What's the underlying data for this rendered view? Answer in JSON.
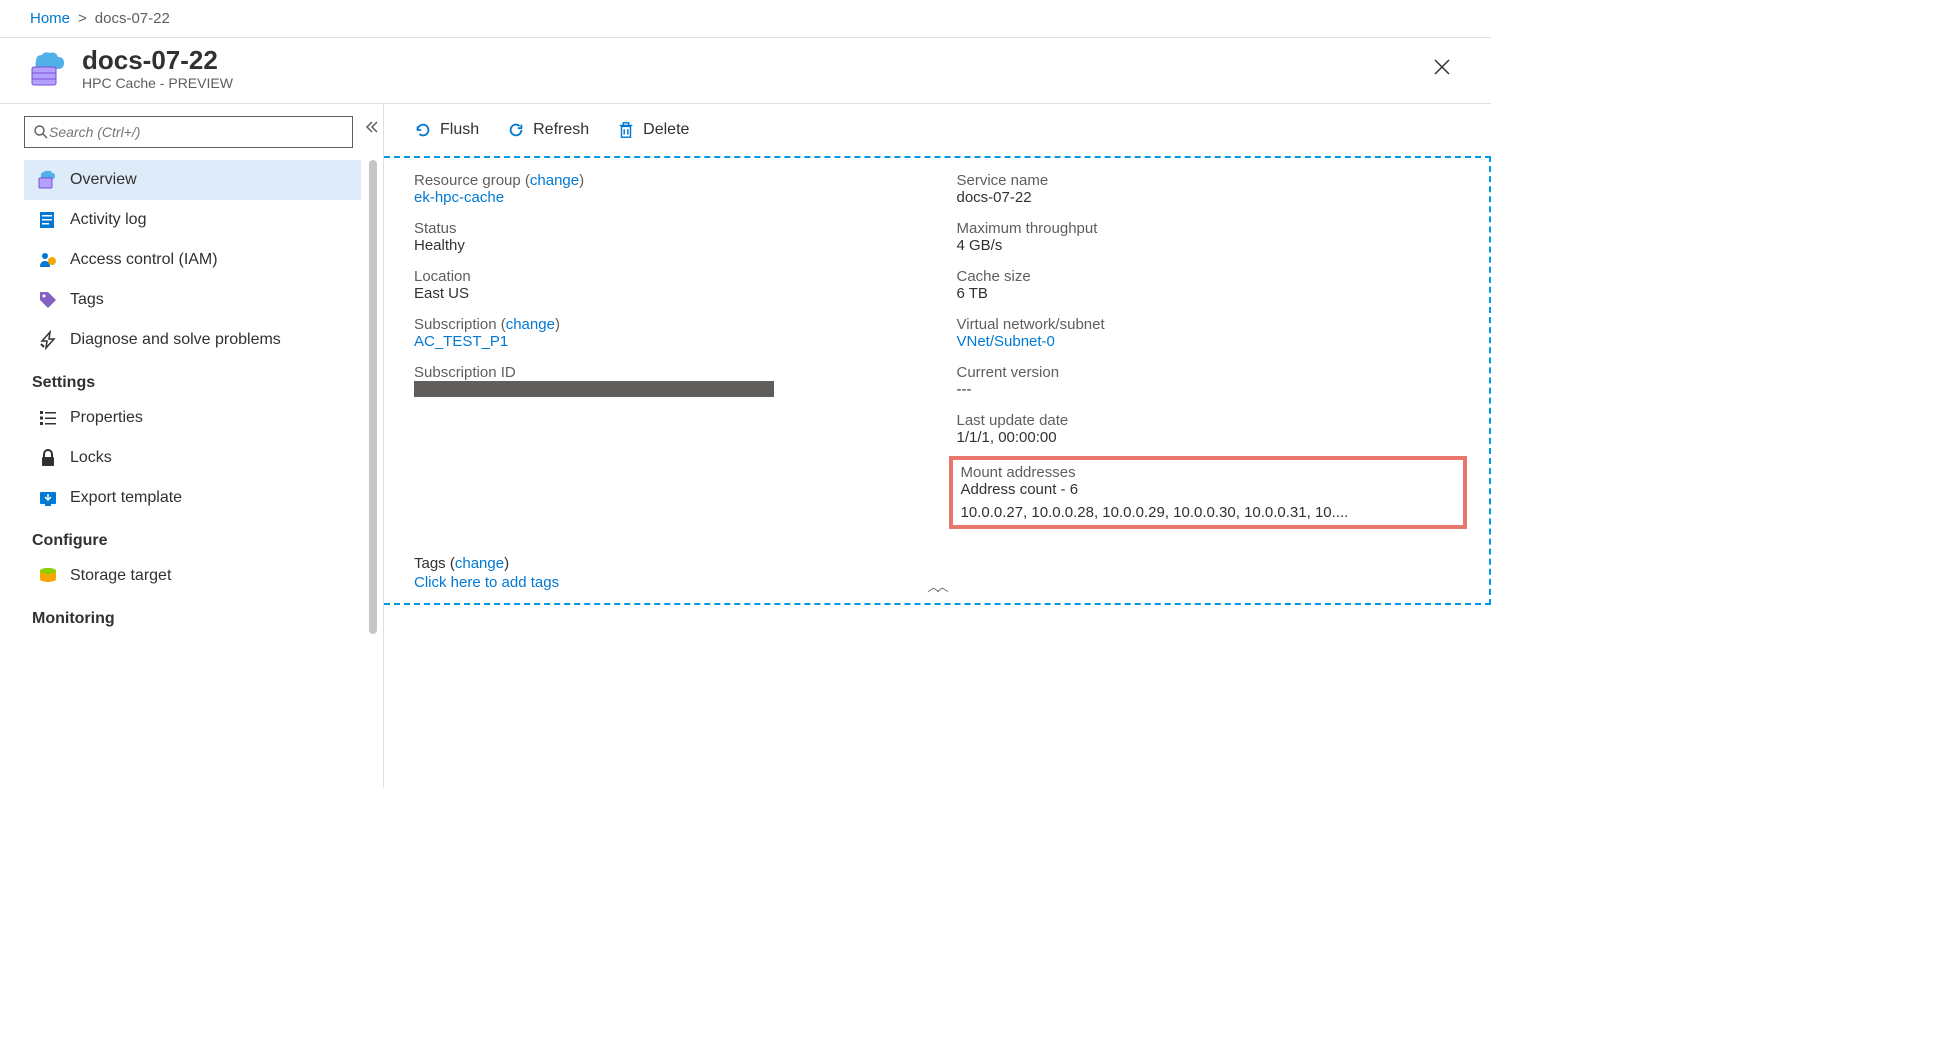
{
  "breadcrumb": {
    "home": "Home",
    "current": "docs-07-22"
  },
  "header": {
    "title": "docs-07-22",
    "subtitle": "HPC Cache - PREVIEW"
  },
  "search": {
    "placeholder": "Search (Ctrl+/)"
  },
  "nav": {
    "overview": "Overview",
    "activity_log": "Activity log",
    "access_control": "Access control (IAM)",
    "tags": "Tags",
    "diagnose": "Diagnose and solve problems",
    "group_settings": "Settings",
    "properties": "Properties",
    "locks": "Locks",
    "export_template": "Export template",
    "group_configure": "Configure",
    "storage_target": "Storage target",
    "group_monitoring": "Monitoring"
  },
  "toolbar": {
    "flush": "Flush",
    "refresh": "Refresh",
    "delete": "Delete"
  },
  "essentials": {
    "left": {
      "resource_group_label": "Resource group (",
      "change": "change",
      "resource_group_value": "ek-hpc-cache",
      "status_label": "Status",
      "status_value": "Healthy",
      "location_label": "Location",
      "location_value": "East US",
      "subscription_label": "Subscription (",
      "subscription_value": "AC_TEST_P1",
      "subscription_id_label": "Subscription ID"
    },
    "right": {
      "service_name_label": "Service name",
      "service_name_value": "docs-07-22",
      "max_throughput_label": "Maximum throughput",
      "max_throughput_value": "4 GB/s",
      "cache_size_label": "Cache size",
      "cache_size_value": "6 TB",
      "vnet_label": "Virtual network/subnet",
      "vnet_value": "VNet/Subnet-0",
      "current_version_label": "Current version",
      "current_version_value": "---",
      "last_update_label": "Last update date",
      "last_update_value": "1/1/1, 00:00:00",
      "mount_label": "Mount addresses",
      "mount_count": "Address count - 6",
      "mount_list": "10.0.0.27, 10.0.0.28, 10.0.0.29, 10.0.0.30, 10.0.0.31, 10...."
    },
    "tags_label": "Tags (",
    "tags_add": "Click here to add tags"
  }
}
